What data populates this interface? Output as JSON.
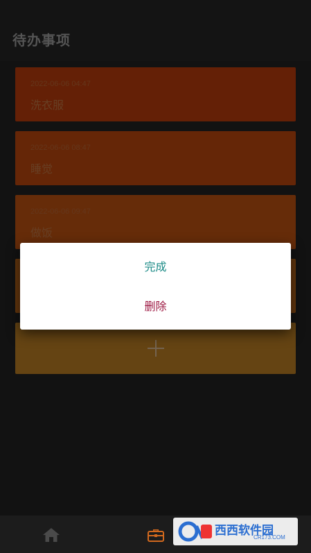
{
  "appbar": {
    "title": "待办事项"
  },
  "todos": [
    {
      "time": "2022-06-06 04:47",
      "title": "洗衣服",
      "color": "#6a2207"
    },
    {
      "time": "2022-06-06 08:47",
      "title": "睡觉",
      "color": "#6b2908"
    },
    {
      "time": "2022-06-06 09:47",
      "title": "做饭",
      "color": "#6c2f0a"
    },
    {
      "time": "",
      "title": "",
      "color": "#6b3a0e"
    }
  ],
  "add_card": {
    "color": "#6b4815",
    "icon": "plus-icon"
  },
  "dialog": {
    "complete_label": "完成",
    "delete_label": "删除",
    "complete_color": "#1a8a86",
    "delete_color": "#9e1b44"
  },
  "bottom_nav": {
    "items": [
      {
        "icon": "home-icon",
        "color": "#4a4a4a"
      },
      {
        "icon": "briefcase-icon",
        "color": "#d2691e"
      }
    ]
  },
  "watermark": {
    "brand": "西西软件园",
    "site": "CR173.COM"
  }
}
